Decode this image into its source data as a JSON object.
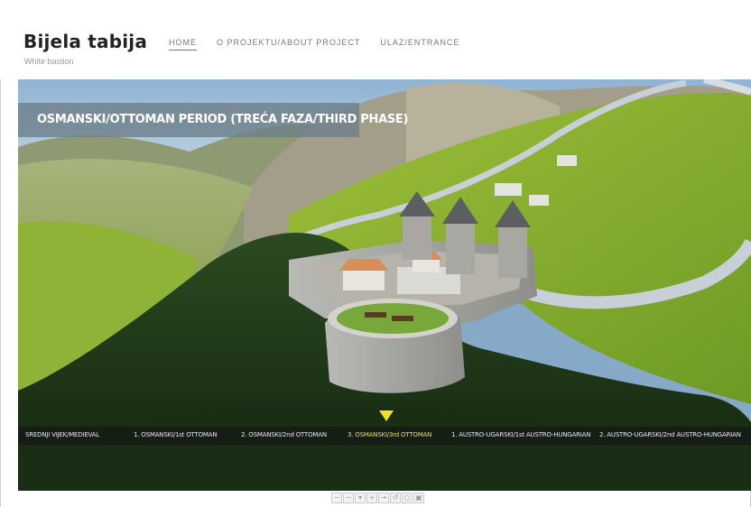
{
  "header": {
    "site_title": "Bijela tabija",
    "site_subtitle": "White bastion"
  },
  "nav": {
    "items": [
      {
        "label": "HOME",
        "active": true
      },
      {
        "label": "O PROJEKTU/ABOUT PROJECT",
        "active": false
      },
      {
        "label": "ULAZ/ENTRANCE",
        "active": false
      }
    ]
  },
  "viewer": {
    "period_title": "OSMANSKI/OTTOMAN PERIOD (TREĆA FAZA/THIRD PHASE)"
  },
  "timeline": {
    "items": [
      {
        "label": "SREDNJI VIJEK/MEDIEVAL",
        "active": false
      },
      {
        "label": "1. OSMANSKI/1st OTTOMAN",
        "active": false
      },
      {
        "label": "2. OSMANSKI/2nd OTTOMAN",
        "active": false
      },
      {
        "label": "3. OSMANSKI/3rd OTTOMAN",
        "active": true
      },
      {
        "label": "1. AUSTRO-UGARSKI/1st AUSTRO-HUNGARIAN",
        "active": false
      },
      {
        "label": "2. AUSTRO-UGARSKI/2nd AUSTRO-HUNGARIAN",
        "active": false
      }
    ]
  },
  "controls": {
    "icons": [
      "zoom-out-icon",
      "zoom-minus-icon",
      "move-up-icon",
      "move-down-icon",
      "move-right-icon",
      "rotate-left-icon",
      "reset-icon",
      "fullscreen-icon"
    ],
    "glyphs": [
      "−",
      "−",
      "▾",
      "+",
      "→",
      "↺",
      "○",
      "▣"
    ]
  },
  "colors": {
    "timeline_active": "#e9e23a",
    "marker": "#f0e21c",
    "title_bar": "#6e808c"
  }
}
